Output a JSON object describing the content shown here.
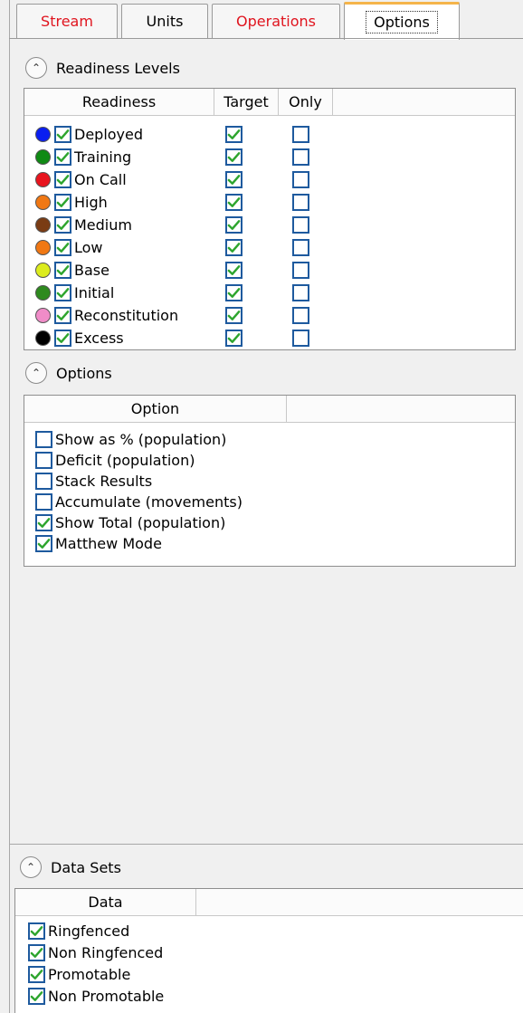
{
  "tabs": [
    {
      "label": "Stream",
      "color": "red"
    },
    {
      "label": "Units",
      "color": "black"
    },
    {
      "label": "Operations",
      "color": "red"
    },
    {
      "label": "Options",
      "color": "black",
      "active": true
    }
  ],
  "readiness": {
    "header": "Readiness Levels",
    "columns": [
      "Readiness",
      "Target",
      "Only"
    ],
    "rows": [
      {
        "label": "Deployed",
        "color": "#0a1ef0",
        "checked": true,
        "target": true,
        "only": false
      },
      {
        "label": "Training",
        "color": "#0f8a14",
        "checked": true,
        "target": true,
        "only": false
      },
      {
        "label": "On Call",
        "color": "#e8141e",
        "checked": true,
        "target": true,
        "only": false
      },
      {
        "label": "High",
        "color": "#f07814",
        "checked": true,
        "target": true,
        "only": false
      },
      {
        "label": "Medium",
        "color": "#7a3c14",
        "checked": true,
        "target": true,
        "only": false
      },
      {
        "label": "Low",
        "color": "#f07814",
        "checked": true,
        "target": true,
        "only": false
      },
      {
        "label": "Base",
        "color": "#dcec1e",
        "checked": true,
        "target": true,
        "only": false
      },
      {
        "label": "Initial",
        "color": "#2e8a1e",
        "checked": true,
        "target": true,
        "only": false
      },
      {
        "label": "Reconstitution",
        "color": "#f08cc8",
        "checked": true,
        "target": true,
        "only": false
      },
      {
        "label": "Excess",
        "color": "#000000",
        "checked": true,
        "target": true,
        "only": false
      }
    ]
  },
  "options": {
    "header": "Options",
    "column": "Option",
    "rows": [
      {
        "label": "Show as % (population)",
        "checked": false
      },
      {
        "label": "Deficit (population)",
        "checked": false
      },
      {
        "label": "Stack Results",
        "checked": false
      },
      {
        "label": "Accumulate (movements)",
        "checked": false
      },
      {
        "label": "Show Total (population)",
        "checked": true
      },
      {
        "label": "Matthew Mode",
        "checked": true
      }
    ]
  },
  "datasets": {
    "header": "Data Sets",
    "column": "Data",
    "rows": [
      {
        "label": "Ringfenced",
        "checked": true
      },
      {
        "label": "Non Ringfenced",
        "checked": true
      },
      {
        "label": "Promotable",
        "checked": true
      },
      {
        "label": "Non Promotable",
        "checked": true
      }
    ]
  },
  "icons": {
    "collapse": "chevron-up-icon",
    "check": "checkmark-icon"
  },
  "accent": "#1e5a9e",
  "check_color": "#2ea52e"
}
